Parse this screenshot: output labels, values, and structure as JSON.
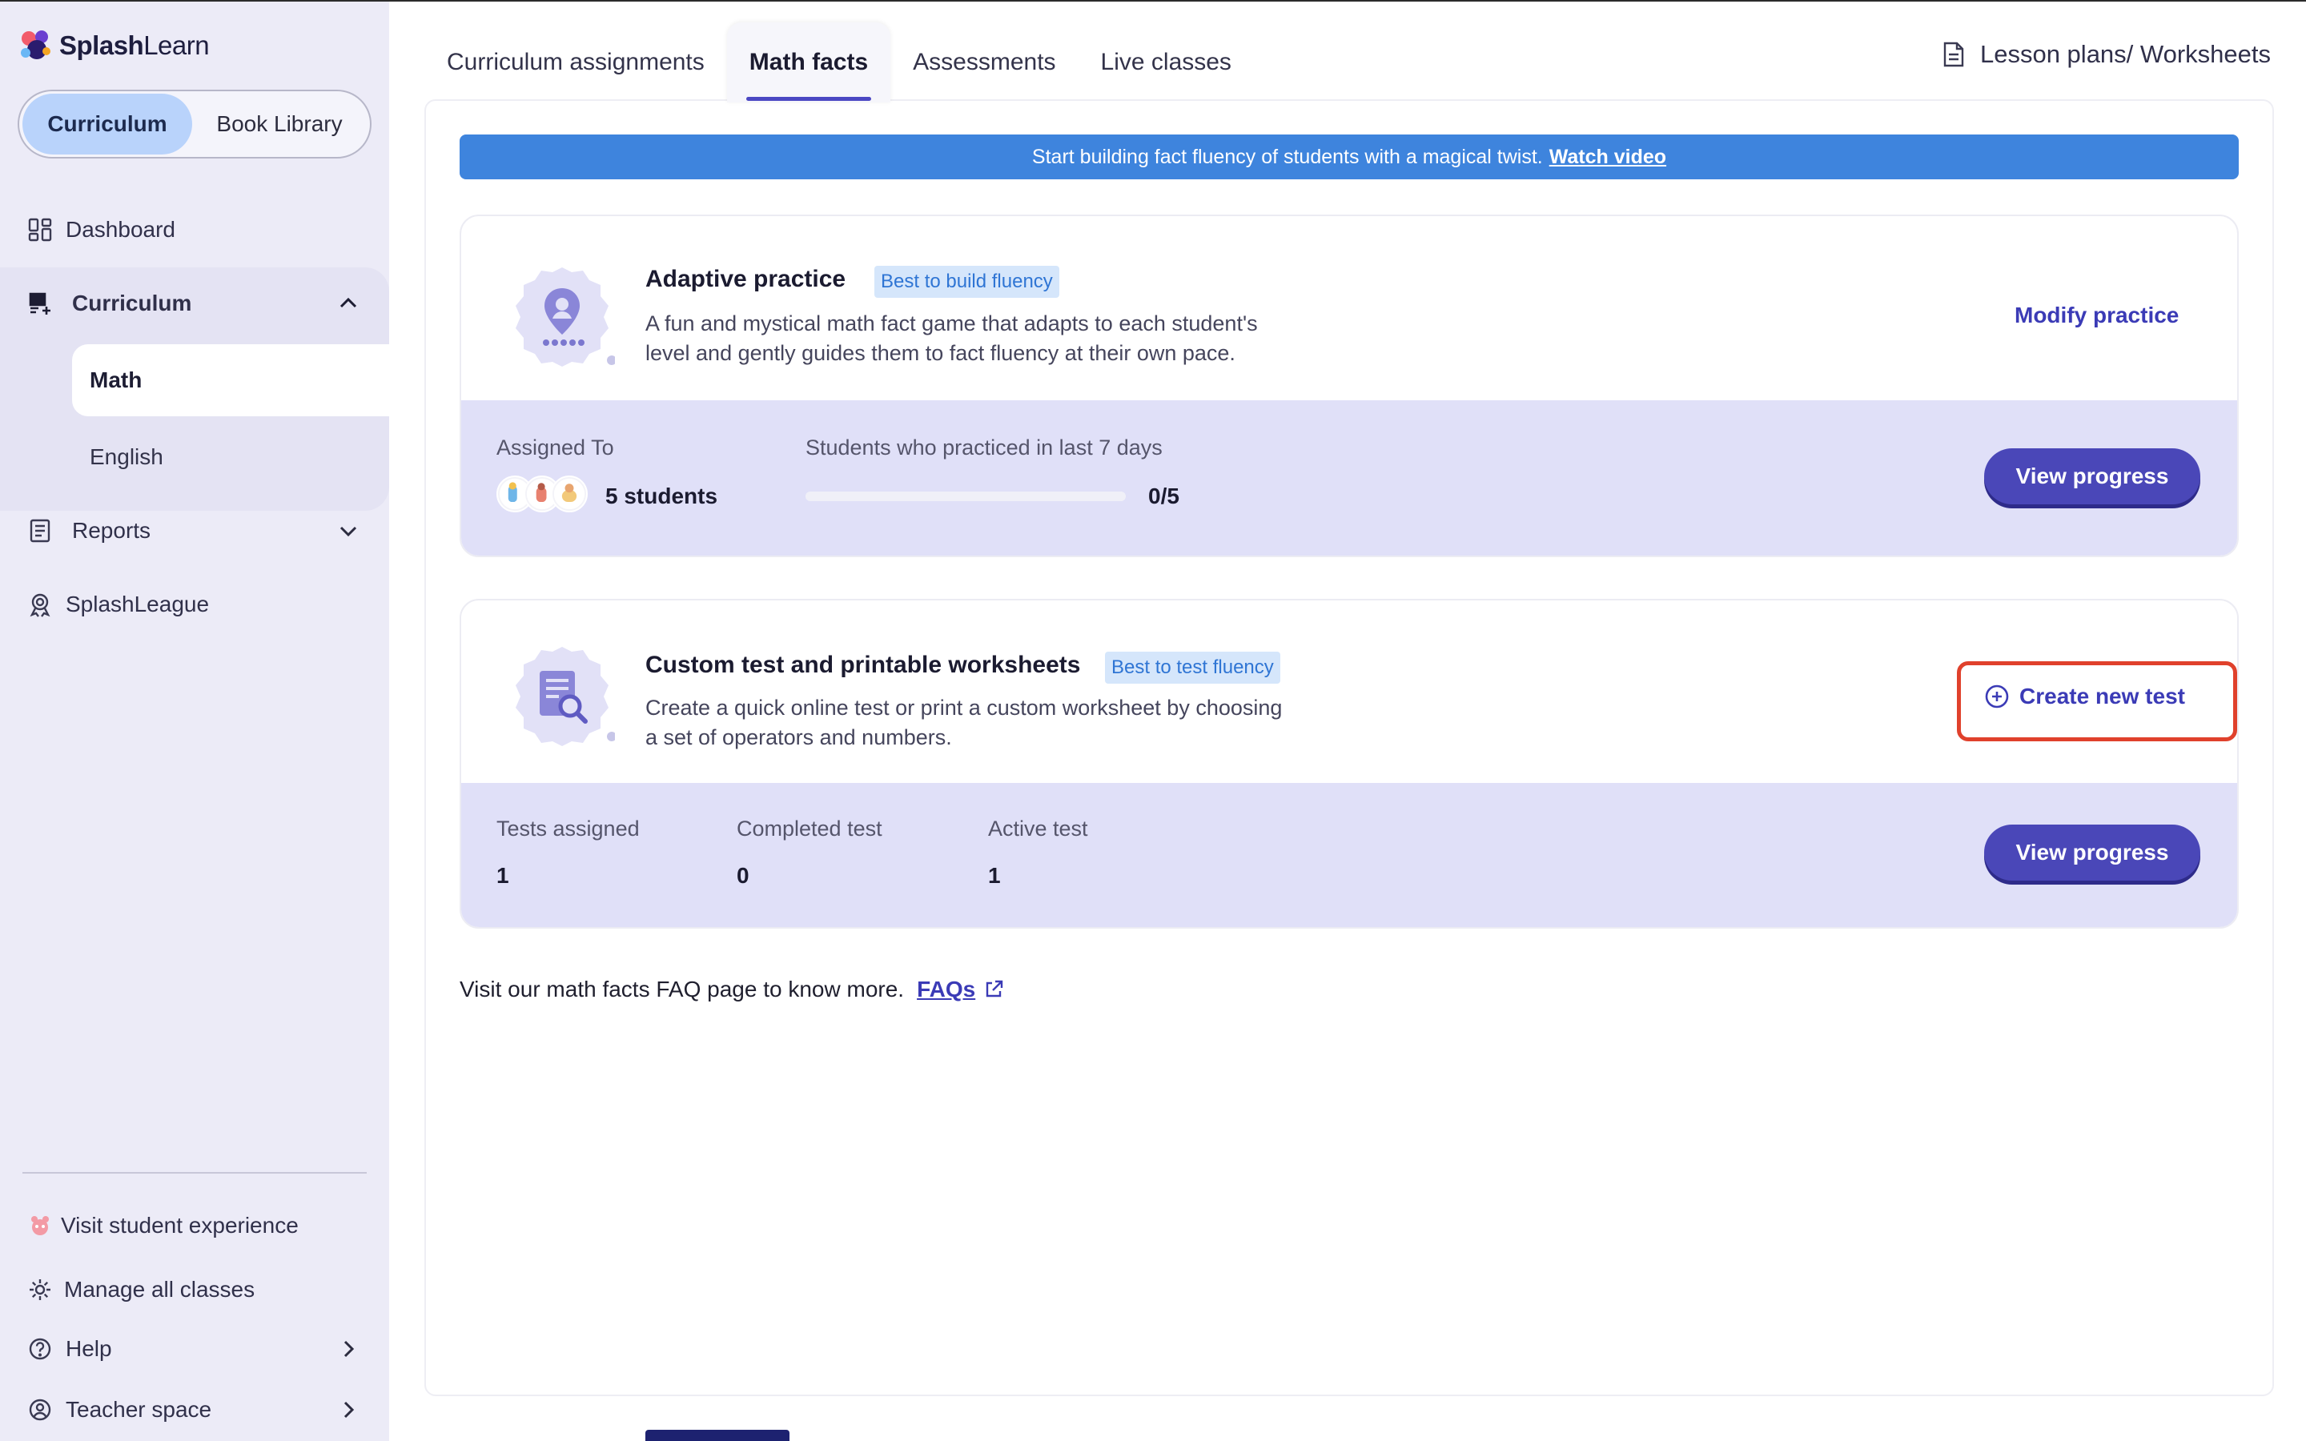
{
  "app": {
    "logo_bold": "Splash",
    "logo_light": "Learn"
  },
  "sidebar": {
    "segment": {
      "active": "Curriculum",
      "inactive": "Book Library"
    },
    "nav": {
      "dashboard": "Dashboard",
      "curriculum": "Curriculum",
      "math": "Math",
      "english": "English",
      "reports": "Reports",
      "splashleague": "SplashLeague"
    },
    "bottom": {
      "visit": "Visit student experience",
      "manage": "Manage all classes",
      "help": "Help",
      "teacher": "Teacher space"
    }
  },
  "tabs": [
    {
      "label": "Curriculum assignments",
      "active": false
    },
    {
      "label": "Math facts",
      "active": true
    },
    {
      "label": "Assessments",
      "active": false
    },
    {
      "label": "Live classes",
      "active": false
    }
  ],
  "lesson_link": "Lesson plans/ Worksheets",
  "banner": {
    "text": "Start building fact fluency of students with a magical twist.",
    "link": "Watch video"
  },
  "adaptive": {
    "title": "Adaptive practice",
    "tag": "Best to build fluency",
    "desc_line1": "A fun and mystical math fact game that adapts to each student's",
    "desc_line2": "level and gently guides them to fact fluency at their own pace.",
    "action": "Modify practice",
    "assigned_label": "Assigned To",
    "assigned_value": "5 students",
    "practiced_label": "Students who practiced in last 7 days",
    "practiced_value": "0/5",
    "practiced_fraction": 0,
    "button": "View progress"
  },
  "custom": {
    "title": "Custom test and printable worksheets",
    "tag": "Best to test fluency",
    "desc_line1": "Create a quick online test or print a custom worksheet by choosing",
    "desc_line2": "a set of operators and numbers.",
    "action": "Create new test",
    "tests_label": "Tests assigned",
    "tests_value": "1",
    "completed_label": "Completed test",
    "completed_value": "0",
    "active_label": "Active test",
    "active_value": "1",
    "button": "View progress"
  },
  "faq": {
    "text": "Visit our math facts FAQ page to know more.",
    "link": "FAQs"
  },
  "colors": {
    "accent": "#4a47b8",
    "banner": "#3e84dd",
    "highlight": "#e0412c",
    "card_stats_bg": "#e0e0f8"
  }
}
